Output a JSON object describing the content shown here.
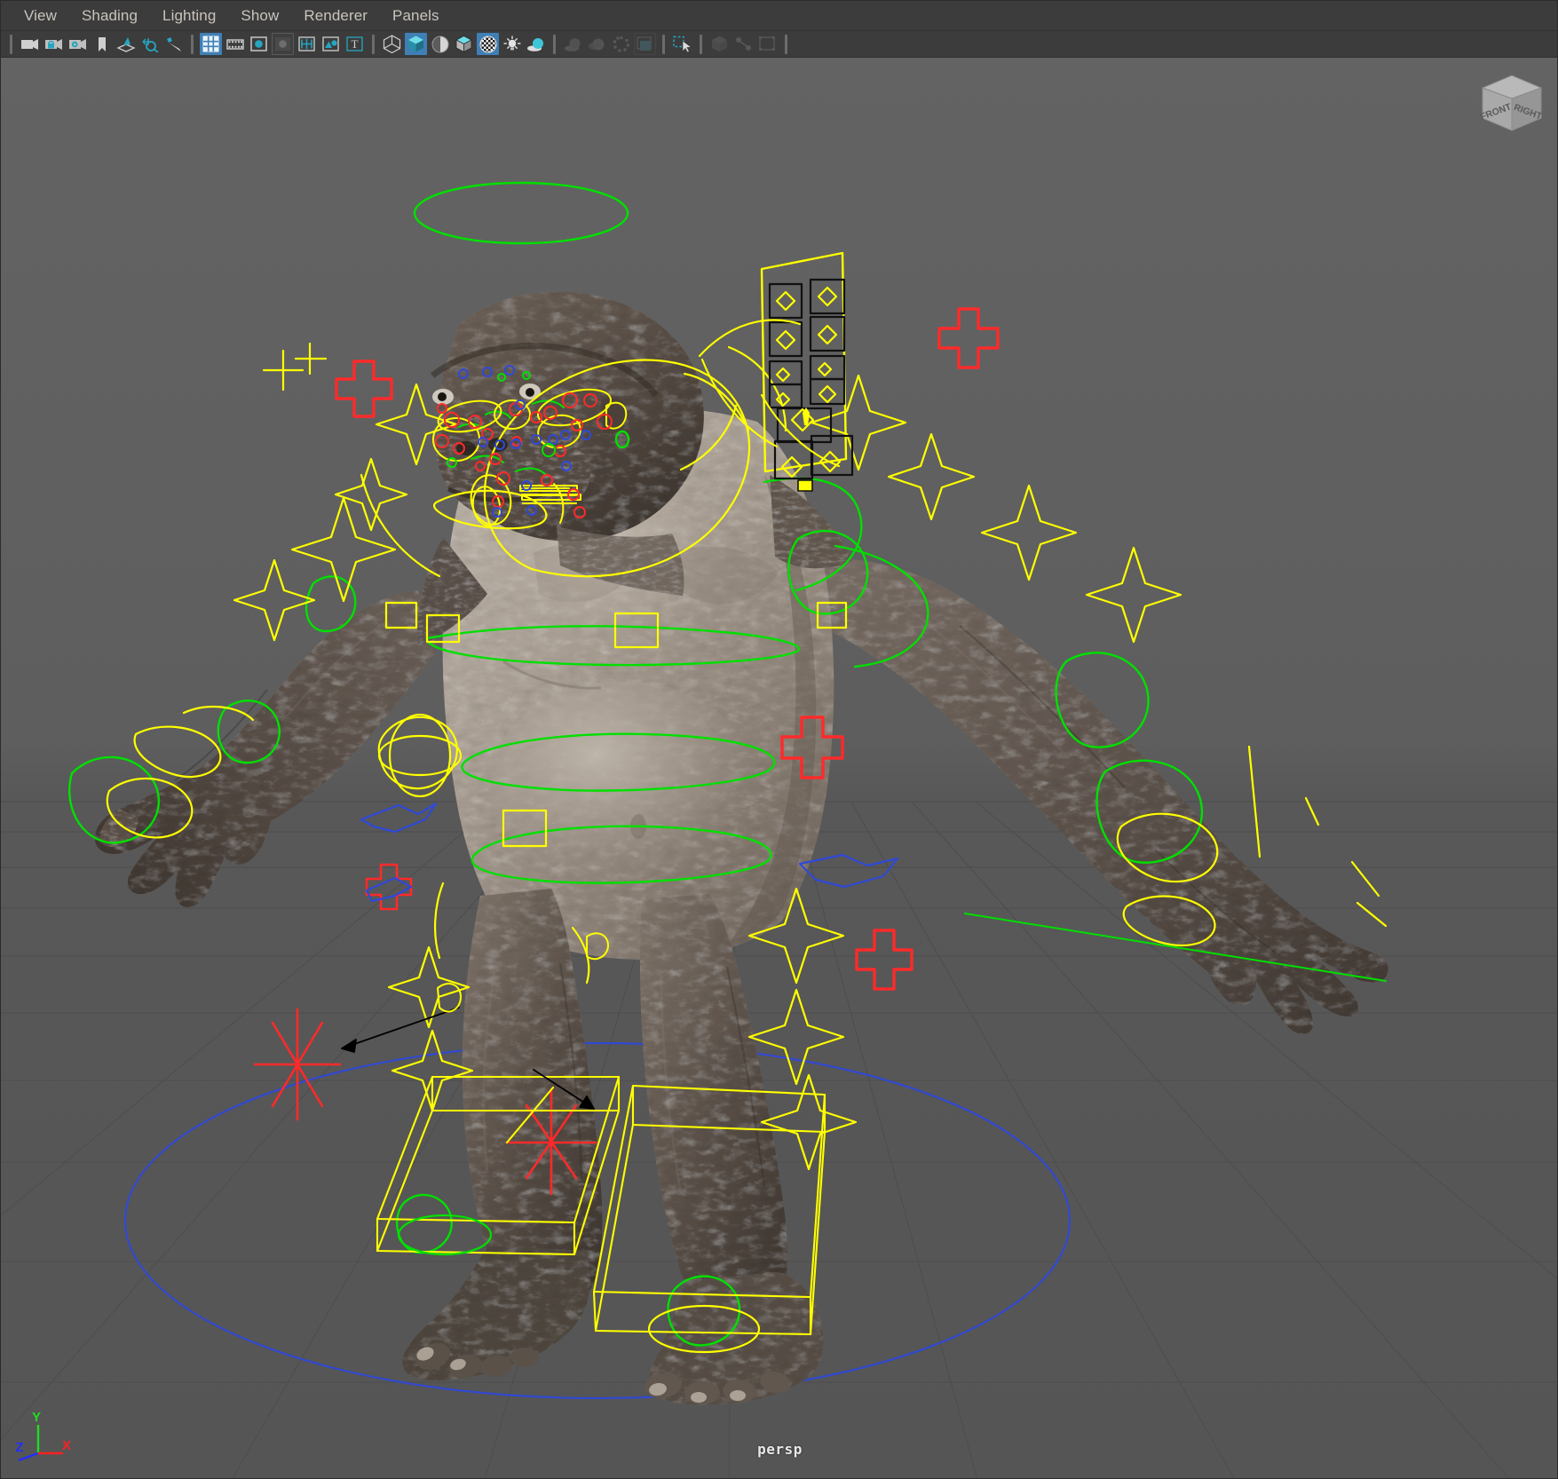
{
  "app": {
    "name": "Autodesk Maya Viewport",
    "camera_label": "persp"
  },
  "menubar": {
    "items": [
      {
        "label": "View",
        "name": "menu-view"
      },
      {
        "label": "Shading",
        "name": "menu-shading"
      },
      {
        "label": "Lighting",
        "name": "menu-lighting"
      },
      {
        "label": "Show",
        "name": "menu-show"
      },
      {
        "label": "Renderer",
        "name": "menu-renderer"
      },
      {
        "label": "Panels",
        "name": "menu-panels"
      }
    ]
  },
  "toolbar": {
    "items": [
      {
        "icon": "select-camera-icon",
        "state": "normal"
      },
      {
        "icon": "lock-camera-icon",
        "state": "normal"
      },
      {
        "icon": "camera-attributes-icon",
        "state": "normal"
      },
      {
        "icon": "bookmark-icon",
        "state": "normal"
      },
      {
        "icon": "image-plane-icon",
        "state": "normal"
      },
      {
        "icon": "two-d-pan-zoom-icon",
        "state": "normal"
      },
      {
        "icon": "grease-pencil-icon",
        "state": "normal"
      },
      {
        "icon": "grid-icon",
        "state": "active"
      },
      {
        "icon": "film-gate-icon",
        "state": "normal"
      },
      {
        "icon": "resolution-gate-icon",
        "state": "normal"
      },
      {
        "icon": "gate-mask-icon",
        "state": "framed"
      },
      {
        "icon": "field-chart-icon",
        "state": "normal"
      },
      {
        "icon": "safe-action-icon",
        "state": "normal"
      },
      {
        "icon": "title-safe-icon",
        "state": "normal"
      },
      {
        "icon": "wireframe-icon",
        "state": "normal"
      },
      {
        "icon": "smooth-shade-all-icon",
        "state": "active"
      },
      {
        "icon": "shade-selected-icon",
        "state": "normal"
      },
      {
        "icon": "wireframe-on-shaded-icon",
        "state": "normal"
      },
      {
        "icon": "texture-icon",
        "state": "active"
      },
      {
        "icon": "use-lights-icon",
        "state": "normal"
      },
      {
        "icon": "shadows-icon",
        "state": "normal"
      },
      {
        "icon": "screen-space-ao-icon",
        "state": "dim"
      },
      {
        "icon": "motion-blur-icon",
        "state": "dim"
      },
      {
        "icon": "multisample-aa-icon",
        "state": "dim"
      },
      {
        "icon": "depth-peeling-icon",
        "state": "framed-dim"
      },
      {
        "icon": "isolate-select-icon",
        "state": "normal"
      },
      {
        "icon": "xray-icon",
        "state": "dim"
      },
      {
        "icon": "xray-joints-icon",
        "state": "dim"
      },
      {
        "icon": "xray-active-components-icon",
        "state": "dim"
      }
    ]
  },
  "viewcube": {
    "front_label": "FRONT",
    "right_label": "RIGHT"
  },
  "axis_gizmo": {
    "x_label": "X",
    "y_label": "Y",
    "z_label": "Z",
    "x_color": "#ff2020",
    "y_color": "#20dd20",
    "z_color": "#2030ff"
  },
  "scene": {
    "description": "Rigged gorilla / ape character in T-pose with animation control curves",
    "background_color": "#5d5d5d",
    "grid_color": "#4a4a4a",
    "control_colors": {
      "fk_yellow": "#ffff00",
      "ik_green": "#00e000",
      "left_red": "#ff2a2a",
      "right_blue": "#2a4aff",
      "panel_outline": "#ffff00",
      "panel_button": "#111111"
    },
    "control_counts": {
      "yellow_stars": 14,
      "red_crosses": 5,
      "blue_arrows": 2,
      "foot_boxes": 2,
      "picker_buttons": 11
    }
  }
}
